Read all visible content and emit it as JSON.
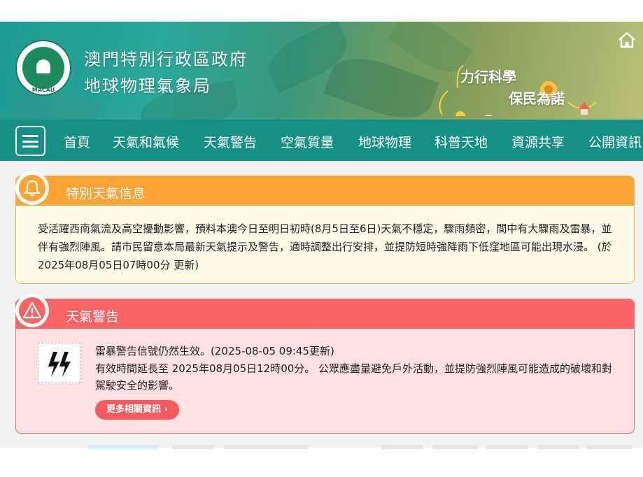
{
  "header": {
    "org_line1": "澳門特別行政區政府",
    "org_line2": "地球物理氣象局",
    "emblem_text": "MACAU",
    "slogan_line1": "力行科學",
    "slogan_line2": "保民為諾",
    "home_icon": "home-icon"
  },
  "nav": {
    "menu_icon": "hamburger-icon",
    "items": [
      {
        "label": "首頁"
      },
      {
        "label": "天氣和氣候"
      },
      {
        "label": "天氣警告"
      },
      {
        "label": "空氣質量"
      },
      {
        "label": "地球物理"
      },
      {
        "label": "科普天地"
      },
      {
        "label": "資源共享"
      },
      {
        "label": "公開資訊"
      }
    ]
  },
  "special_info": {
    "title": "特別天氣信息",
    "icon": "bell-icon",
    "body": "受活躍西南氣流及高空擾動影響，預料本澳今日至明日初時(8月5日至6日)天氣不穩定，驟雨頻密，間中有大驟雨及雷暴，並伴有強烈陣風。請市民留意本局最新天氣提示及警告，適時調整出行安排，並提防短時強降雨下低窪地區可能出現水浸。 (於 2025年08月05日07時00分 更新)"
  },
  "weather_warning": {
    "title": "天氣警告",
    "icon": "alert-icon",
    "warning_icon": "thunderstorm-icon",
    "line1": "雷暴警告信號仍然生效。(2025-08-05 09:45更新)",
    "line2": "有效時間延長至 2025年08月05日12時00分。 公眾應盡量避免戶外活動，並提防強烈陣風可能造成的破壞和對駕駛安全的影響。",
    "more_button": "更多相關資訊"
  },
  "colors": {
    "nav_bg": "#168f86",
    "special_head": "#fca336",
    "special_body": "#fffaea",
    "warning_head": "#f86466",
    "warning_body": "#ffe0e3",
    "more_button": "#f45a5f"
  }
}
